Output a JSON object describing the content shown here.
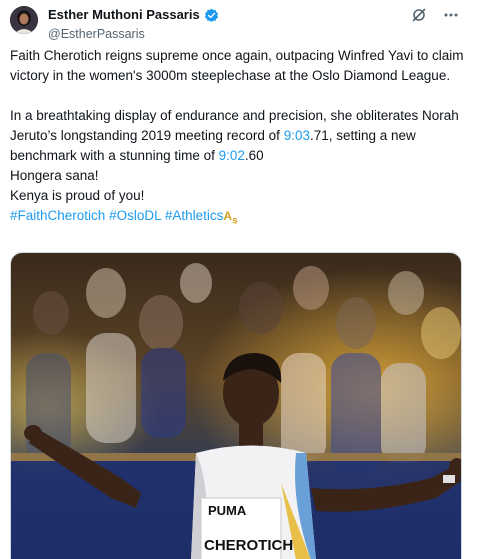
{
  "author": {
    "display_name": "Esther Muthoni Passaris",
    "handle": "@EstherPassaris"
  },
  "tweet": {
    "p1": "Faith Cherotich reigns supreme once again, outpacing Winfred Yavi to claim victory in the women's 3000m steeplechase at the Oslo Diamond League.",
    "p2_a": "In a breathtaking display of endurance and precision, she obliterates Norah Jeruto’s longstanding 2019 meeting record of ",
    "p2_record_hl": "9:03",
    "p2_b": ".71, setting a new benchmark with a stunning time of ",
    "p2_time_hl": "9:02",
    "p2_c": ".60",
    "line_hongera": "Hongera sana!",
    "line_kenya": "Kenya is proud of you!",
    "hashtags": [
      "#FaithCherotich",
      "#OsloDL",
      "#Athletics"
    ],
    "emoji": "A",
    "emoji_small": "s"
  },
  "media": {
    "bib_brand": "PUMA",
    "bib_name": "CHEROTICH"
  },
  "colors": {
    "link": "#1d9bf0",
    "text": "#0f1419",
    "secondary": "#536471",
    "verified": "#1d9bf0"
  },
  "icons": [
    "verified-badge-icon",
    "grok-icon",
    "more-icon"
  ]
}
